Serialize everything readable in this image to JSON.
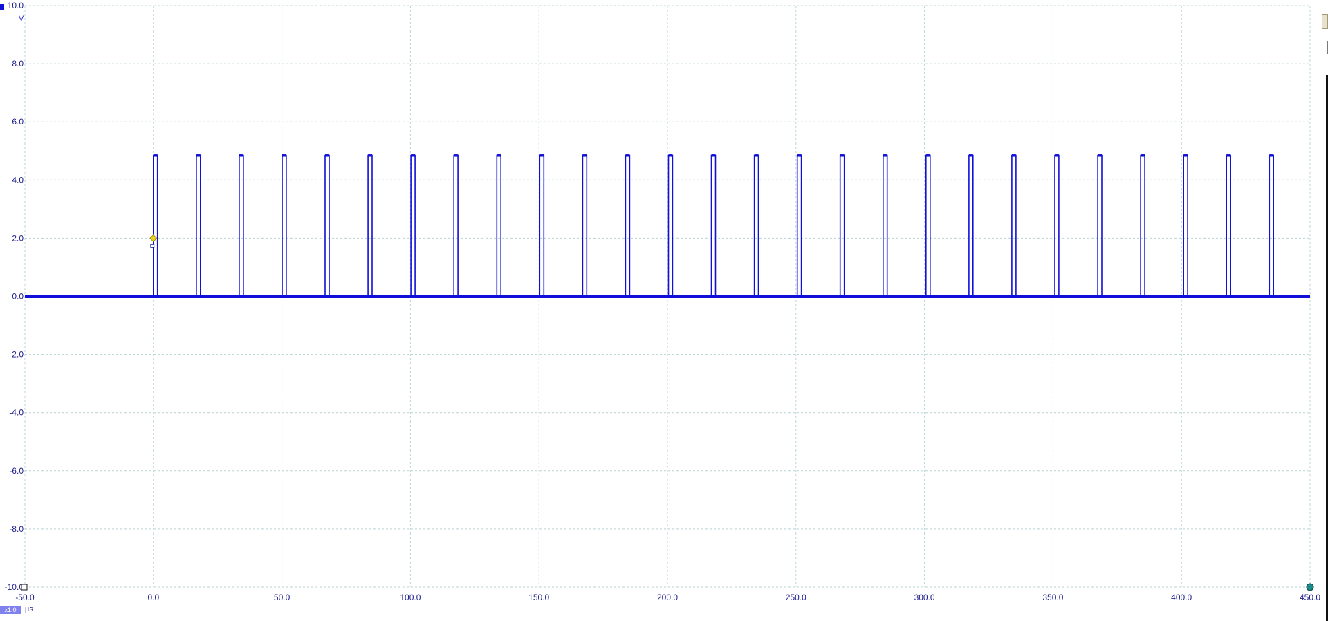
{
  "chart_data": {
    "type": "line",
    "title": "",
    "xlabel": "",
    "ylabel": "",
    "x_unit": "µs",
    "y_unit": "V",
    "xlim": [
      -50,
      450
    ],
    "ylim": [
      -10,
      10
    ],
    "x_ticks": [
      -50,
      0,
      50,
      100,
      150,
      200,
      250,
      300,
      350,
      400,
      450
    ],
    "x_tick_labels": [
      "-50.0",
      "0.0",
      "50.0",
      "100.0",
      "150.0",
      "200.0",
      "250.0",
      "300.0",
      "350.0",
      "400.0",
      "450.0"
    ],
    "y_ticks": [
      10,
      8,
      6,
      4,
      2,
      0,
      -2,
      -4,
      -6,
      -8,
      -10
    ],
    "y_tick_labels": [
      "10.0",
      "8.0",
      "6.0",
      "4.0",
      "2.0",
      "0.0",
      "-2.0",
      "-4.0",
      "-6.0",
      "-8.0",
      "-10.0"
    ],
    "grid": true,
    "series": [
      {
        "color": "#1010d8",
        "pulse_high_v": 4.85,
        "pulse_low_v": 0.0,
        "pulse_starts_us": [
          0.0,
          16.7,
          33.4,
          50.1,
          66.8,
          83.5,
          100.2,
          116.9,
          133.6,
          150.3,
          167.0,
          183.7,
          200.4,
          217.1,
          233.8,
          250.5,
          267.2,
          283.9,
          300.6,
          317.3,
          334.0,
          350.7,
          367.4,
          384.1,
          400.8,
          417.5,
          434.2
        ],
        "pulse_width_us": 1.6,
        "trace_start_us": -50,
        "trace_end_us": 450
      }
    ],
    "trigger": {
      "time_us": 0.0,
      "level_v": 2.0,
      "color": "#e8d020"
    }
  },
  "footer": {
    "zoom_label": "x1.0",
    "time_unit": "µs"
  },
  "colors": {
    "trace": "#1010d8",
    "grid": "#b8d4d4",
    "labels": "#1c1c8c",
    "end_marker": "#1a8a8a"
  }
}
